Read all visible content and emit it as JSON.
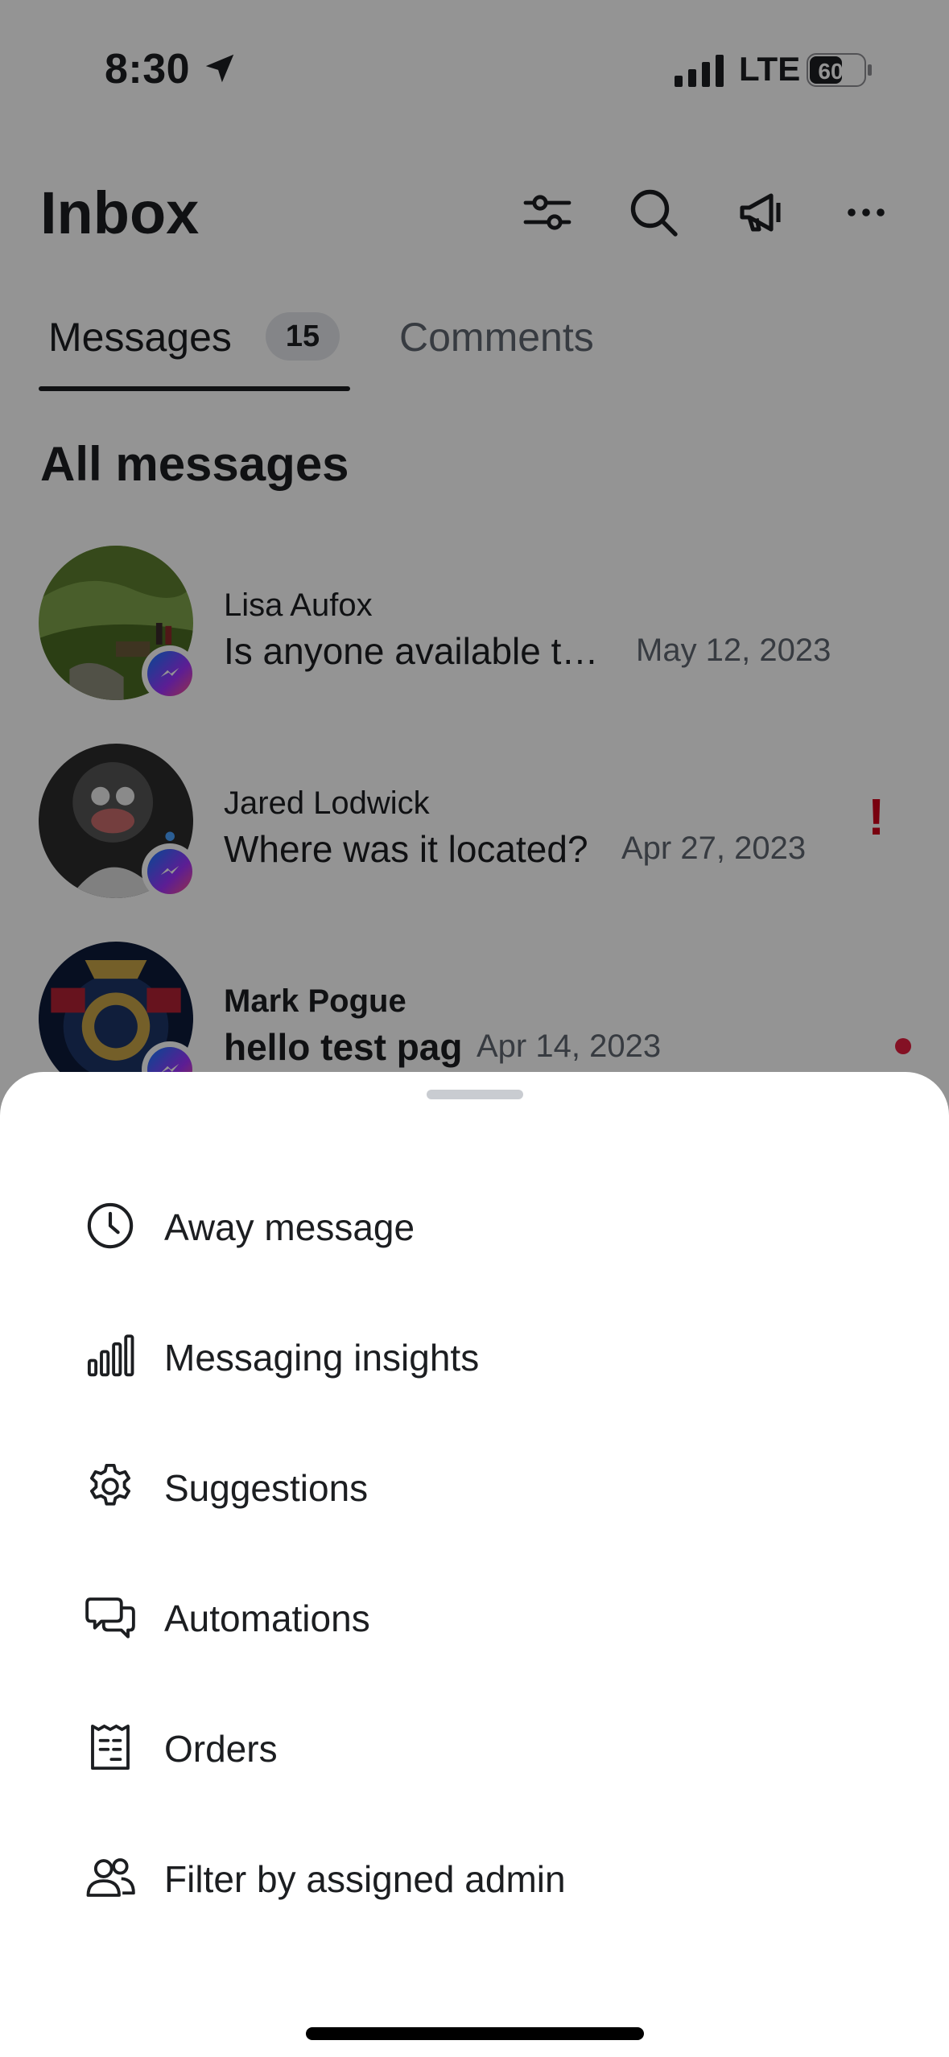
{
  "status_bar": {
    "time": "8:30",
    "network": "LTE",
    "battery": "60"
  },
  "header": {
    "title": "Inbox",
    "icons": [
      "filter-sliders-icon",
      "search-icon",
      "megaphone-icon",
      "more-icon"
    ]
  },
  "tabs": {
    "messages_label": "Messages",
    "messages_count": "15",
    "comments_label": "Comments"
  },
  "section_title": "All messages",
  "messages": [
    {
      "name": "Lisa Aufox",
      "preview": "Is anyone available t…",
      "date": "May 12, 2023",
      "unread": false,
      "flag": ""
    },
    {
      "name": "Jared Lodwick",
      "preview": "Where was it located?",
      "date": "Apr 27, 2023",
      "unread": false,
      "flag": "!"
    },
    {
      "name": "Mark Pogue",
      "preview": "hello test pag",
      "date": "Apr 14, 2023",
      "unread": true,
      "flag": ""
    }
  ],
  "sheet": {
    "items": [
      {
        "label": "Away message",
        "icon": "clock-icon"
      },
      {
        "label": "Messaging insights",
        "icon": "bar-chart-icon"
      },
      {
        "label": "Suggestions",
        "icon": "gear-icon"
      },
      {
        "label": "Automations",
        "icon": "chat-bubbles-icon"
      },
      {
        "label": "Orders",
        "icon": "receipt-icon"
      },
      {
        "label": "Filter by assigned admin",
        "icon": "people-icon"
      }
    ]
  },
  "colors": {
    "text": "#1c1e21",
    "secondary_text": "#606770",
    "alert": "#d0021b",
    "unread_dot": "#e41e3f",
    "scrim": "rgba(0,0,0,0.42)"
  }
}
